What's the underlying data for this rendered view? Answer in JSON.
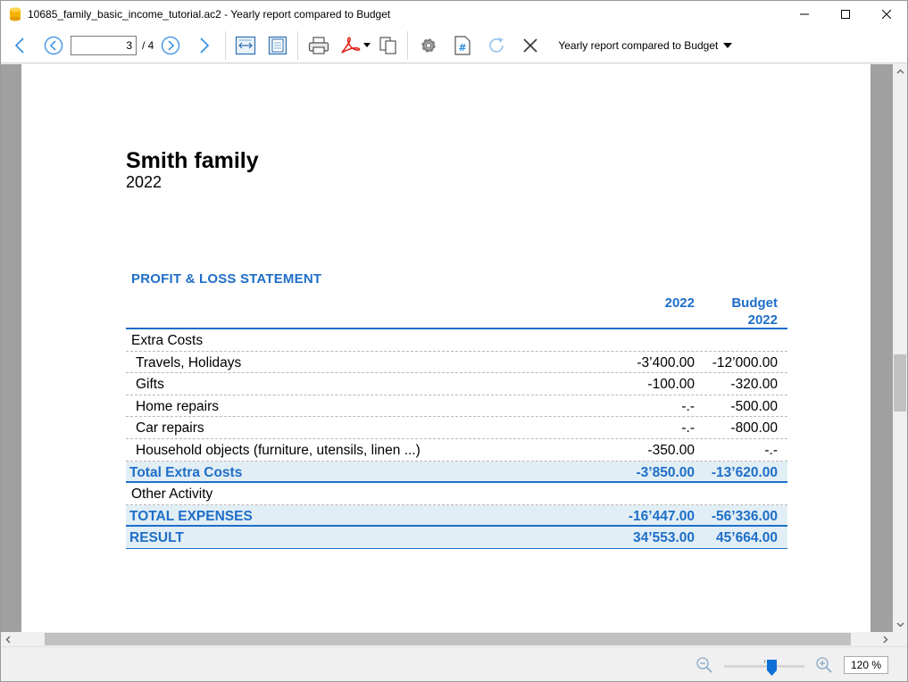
{
  "window": {
    "title": "10685_family_basic_income_tutorial.ac2 - Yearly report compared to Budget",
    "icons": [
      "app-icon",
      "minimize-icon",
      "maximize-icon",
      "close-icon"
    ]
  },
  "toolbar": {
    "current_page": "3",
    "total_pages": "/ 4",
    "report_name": "Yearly report compared to Budget",
    "icons": [
      "back-icon",
      "previous-page-icon",
      "next-page-icon",
      "forward-icon",
      "fit-width-icon",
      "fit-page-icon",
      "print-icon",
      "pdf-icon",
      "copy-icon",
      "settings-icon",
      "format-icon",
      "refresh-icon",
      "close-report-icon"
    ],
    "accent_color": "#1e6ec8"
  },
  "document": {
    "title": "Smith family",
    "year": "2022",
    "section_title": "PROFIT & LOSS STATEMENT",
    "columns": {
      "col1": "2022",
      "col2_line1": "Budget",
      "col2_line2": "2022"
    },
    "rows": [
      {
        "label": "Extra Costs",
        "v1": "",
        "v2": "",
        "type": "group"
      },
      {
        "label": "Travels, Holidays",
        "v1": "-3’400.00",
        "v2": "-12’000.00",
        "type": "item"
      },
      {
        "label": "Gifts",
        "v1": "-100.00",
        "v2": "-320.00",
        "type": "item"
      },
      {
        "label": "Home repairs",
        "v1": "-.-",
        "v2": "-500.00",
        "type": "item"
      },
      {
        "label": "Car repairs",
        "v1": "-.-",
        "v2": "-800.00",
        "type": "item"
      },
      {
        "label": "Household objects (furniture, utensils, linen ...)",
        "v1": "-350.00",
        "v2": "-.-",
        "type": "item"
      },
      {
        "label": "Total Extra Costs",
        "v1": "-3’850.00",
        "v2": "-13’620.00",
        "type": "total"
      },
      {
        "label": "Other Activity",
        "v1": "",
        "v2": "",
        "type": "group"
      },
      {
        "label": "TOTAL EXPENSES",
        "v1": "-16’447.00",
        "v2": "-56’336.00",
        "type": "total"
      },
      {
        "label": "RESULT",
        "v1": "34’553.00",
        "v2": "45’664.00",
        "type": "result"
      }
    ],
    "total_fill_color": "#e1eef5"
  },
  "statusbar": {
    "zoom_value": "120 %",
    "zoom_level": 1.2,
    "icons": [
      "zoom-out-icon",
      "zoom-in-icon"
    ]
  }
}
